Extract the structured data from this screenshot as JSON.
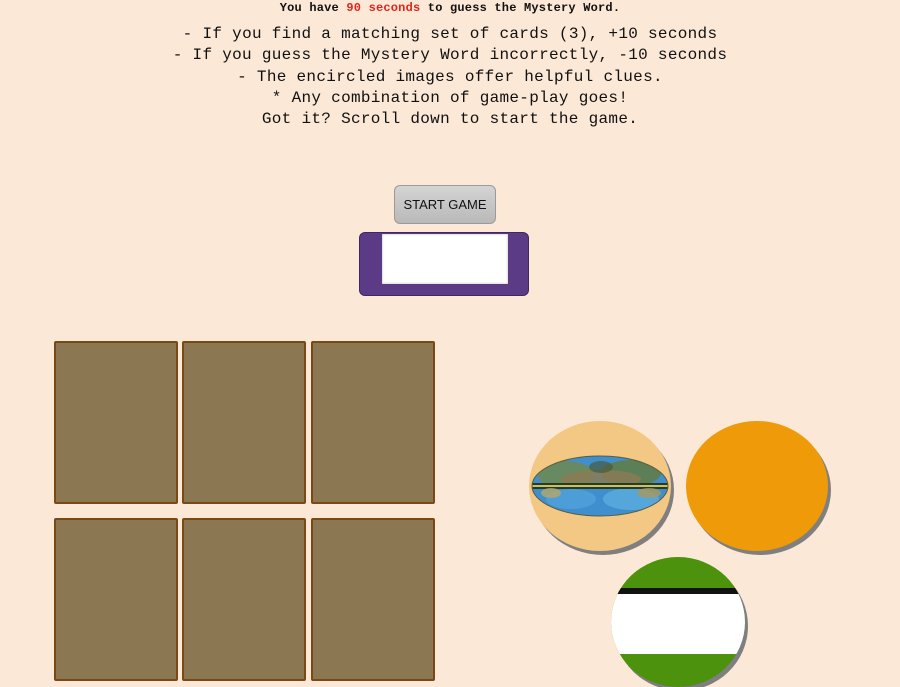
{
  "intro": {
    "prefix": "You have ",
    "time": "90 seconds",
    "suffix": " to guess the Mystery Word."
  },
  "rules": [
    "- If you find a matching set of cards (3), +10 seconds",
    "- If you guess the Mystery Word incorrectly, -10 seconds",
    "- The encircled images offer helpful clues.",
    "* Any combination of game-play goes!",
    "Got it? Scroll down to start the game."
  ],
  "start_button": {
    "label": "START GAME"
  },
  "timer": {
    "value": ""
  },
  "cards": {
    "count": 6,
    "face": "down",
    "back_color": "#8b7752",
    "border_color": "#7a4a16"
  },
  "clues": [
    {
      "name": "sky-map-clue",
      "image": "galaxy-sky-map",
      "color": "#f3c884"
    },
    {
      "name": "orange-clue",
      "image": "solid-orange",
      "color": "#ee9a09"
    },
    {
      "name": "green-clue",
      "image": "green-white-image",
      "color": "#4c920d"
    }
  ],
  "colors": {
    "background": "#fbe8d6",
    "highlight": "#e0261b",
    "timer_frame": "#5b3b86"
  }
}
